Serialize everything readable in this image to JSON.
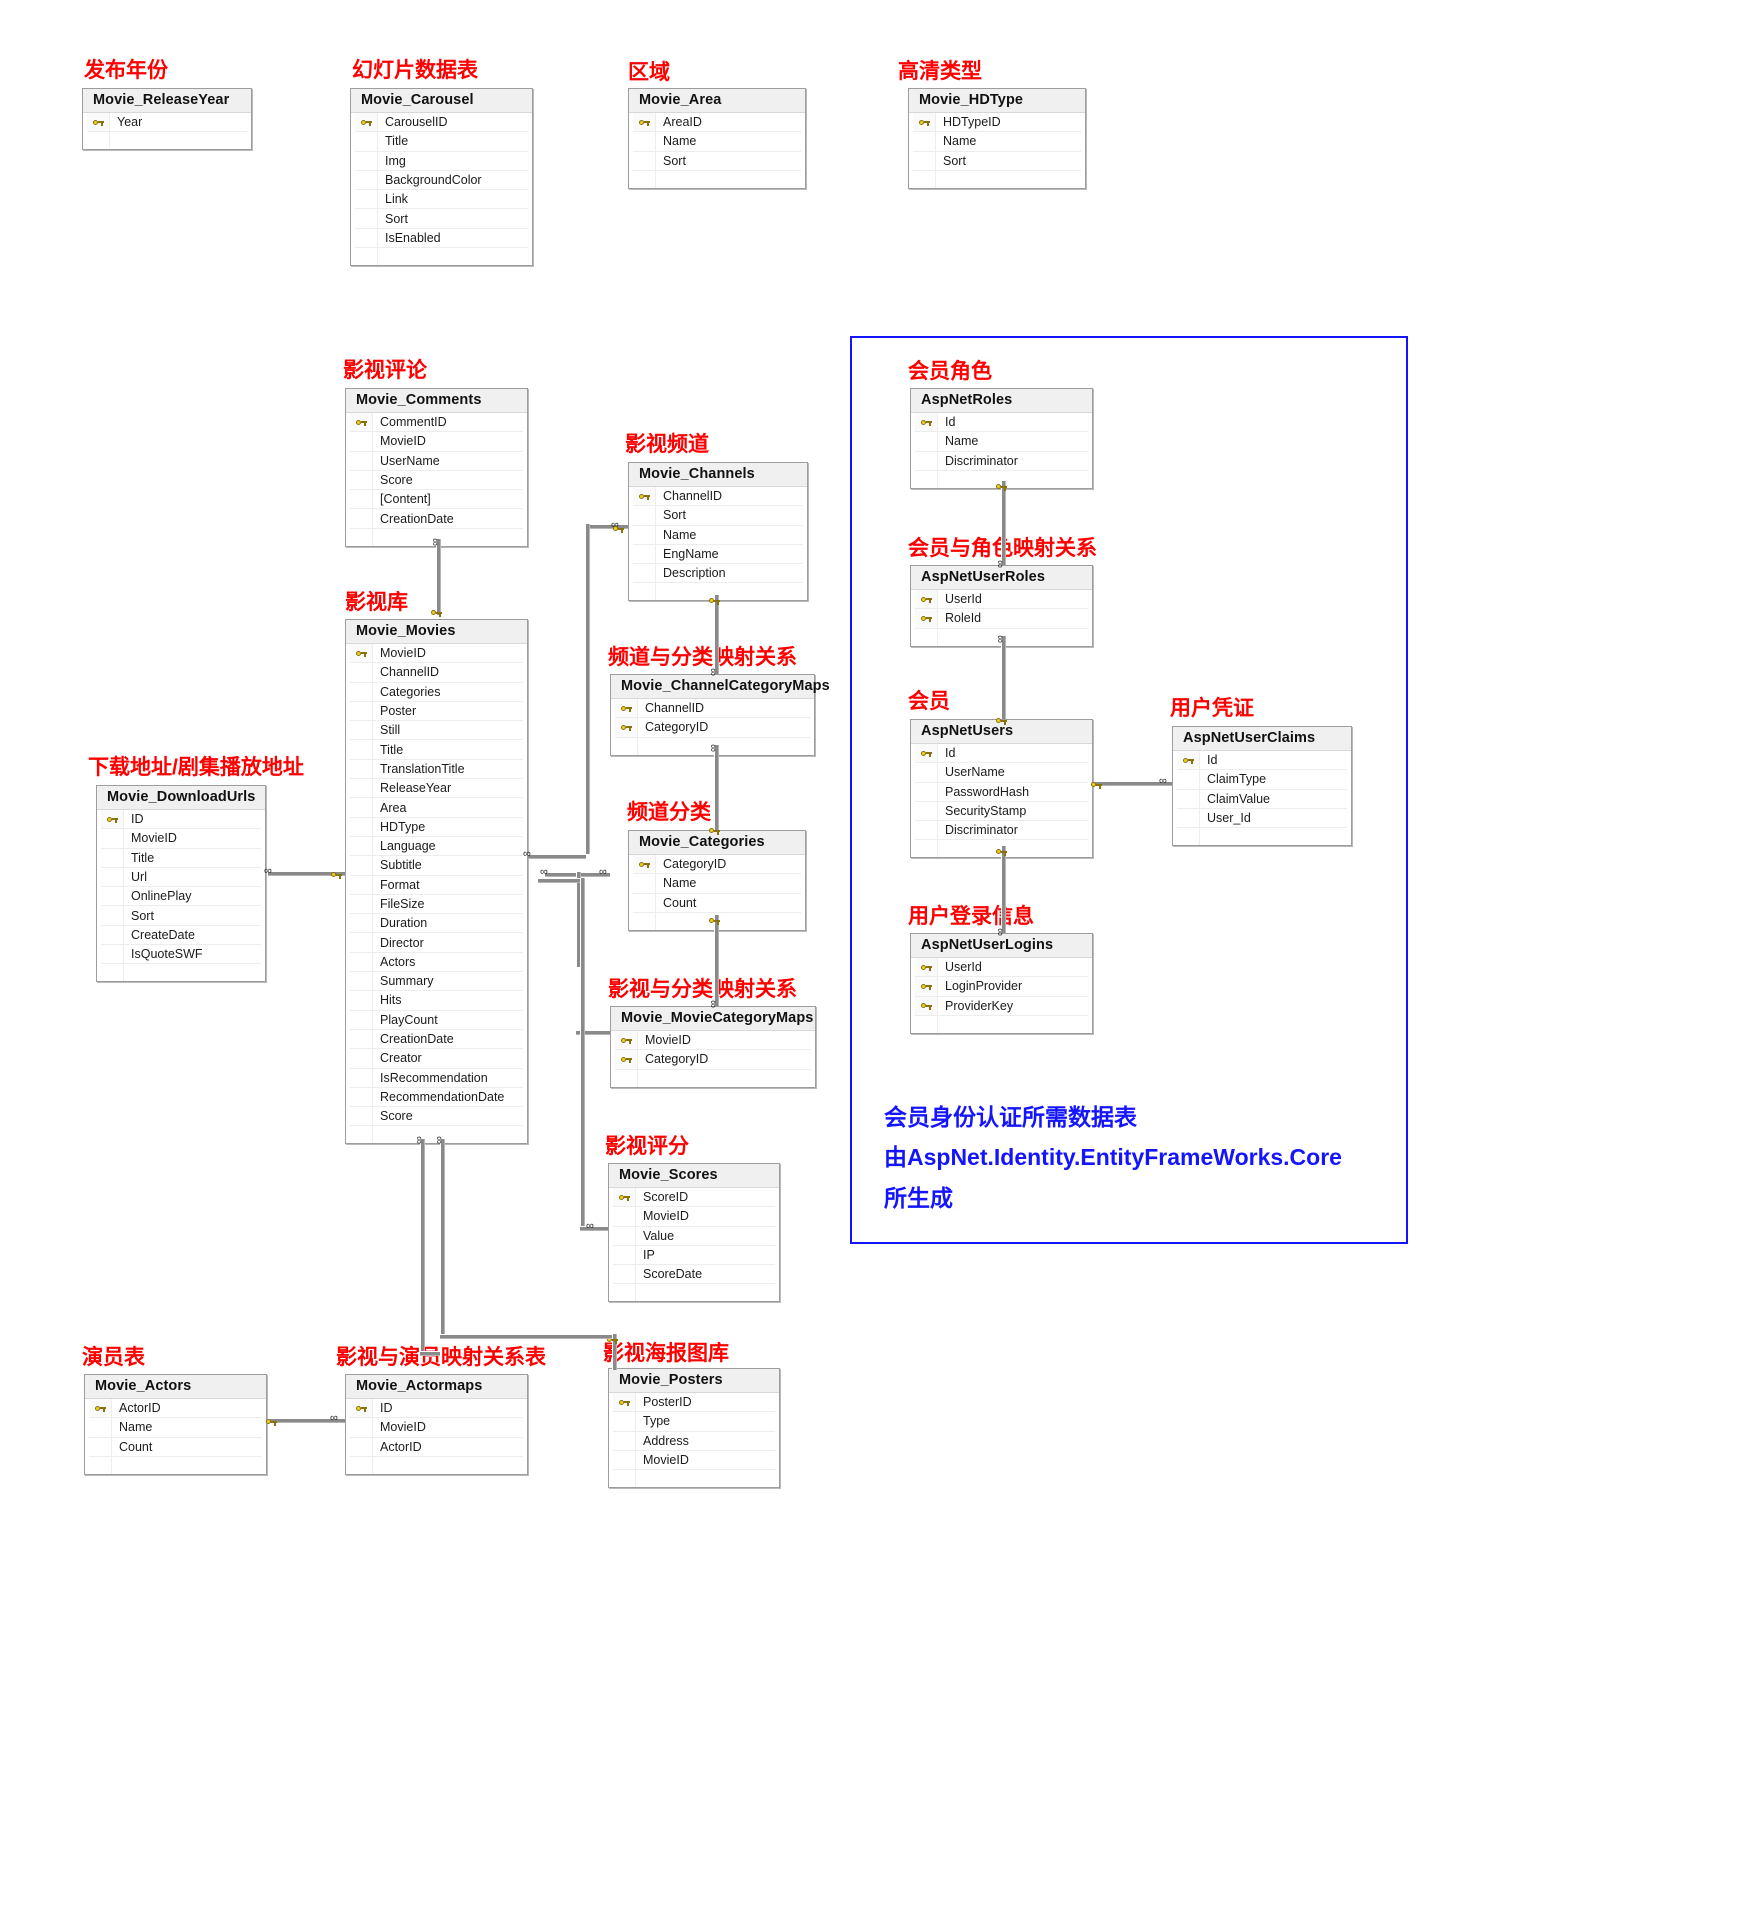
{
  "diagram": {
    "title_note_lines": [
      "会员身份认证所需数据表",
      "由AspNet.Identity.EntityFrameWorks.Core",
      "所生成"
    ],
    "colors": {
      "annotation": "#ff0000",
      "note": "#1414ff",
      "header_bg": "#f0f0f0",
      "border": "#9d9d9d",
      "key": "#f2cf26"
    }
  },
  "tables": [
    {
      "id": "movie-releaseyear",
      "annotation": "发布年份",
      "name": "Movie_ReleaseYear",
      "fields": [
        {
          "name": "Year",
          "key": true
        }
      ]
    },
    {
      "id": "movie-carousel",
      "annotation": "幻灯片数据表",
      "name": "Movie_Carousel",
      "fields": [
        {
          "name": "CarouselID",
          "key": true
        },
        {
          "name": "Title",
          "key": false
        },
        {
          "name": "Img",
          "key": false
        },
        {
          "name": "BackgroundColor",
          "key": false
        },
        {
          "name": "Link",
          "key": false
        },
        {
          "name": "Sort",
          "key": false
        },
        {
          "name": "IsEnabled",
          "key": false
        }
      ]
    },
    {
      "id": "movie-area",
      "annotation": "区域",
      "name": "Movie_Area",
      "fields": [
        {
          "name": "AreaID",
          "key": true
        },
        {
          "name": "Name",
          "key": false
        },
        {
          "name": "Sort",
          "key": false
        }
      ]
    },
    {
      "id": "movie-hdtype",
      "annotation": "高清类型",
      "name": "Movie_HDType",
      "fields": [
        {
          "name": "HDTypeID",
          "key": true
        },
        {
          "name": "Name",
          "key": false
        },
        {
          "name": "Sort",
          "key": false
        }
      ]
    },
    {
      "id": "movie-comments",
      "annotation": "影视评论",
      "name": "Movie_Comments",
      "fields": [
        {
          "name": "CommentID",
          "key": true
        },
        {
          "name": "MovieID",
          "key": false
        },
        {
          "name": "UserName",
          "key": false
        },
        {
          "name": "Score",
          "key": false
        },
        {
          "name": "[Content]",
          "key": false
        },
        {
          "name": "CreationDate",
          "key": false
        }
      ]
    },
    {
      "id": "movie-channels",
      "annotation": "影视频道",
      "name": "Movie_Channels",
      "fields": [
        {
          "name": "ChannelID",
          "key": true
        },
        {
          "name": "Sort",
          "key": false
        },
        {
          "name": "Name",
          "key": false
        },
        {
          "name": "EngName",
          "key": false
        },
        {
          "name": "Description",
          "key": false
        }
      ]
    },
    {
      "id": "movie-movies",
      "annotation": "影视库",
      "name": "Movie_Movies",
      "fields": [
        {
          "name": "MovieID",
          "key": true
        },
        {
          "name": "ChannelID",
          "key": false
        },
        {
          "name": "Categories",
          "key": false
        },
        {
          "name": "Poster",
          "key": false
        },
        {
          "name": "Still",
          "key": false
        },
        {
          "name": "Title",
          "key": false
        },
        {
          "name": "TranslationTitle",
          "key": false
        },
        {
          "name": "ReleaseYear",
          "key": false
        },
        {
          "name": "Area",
          "key": false
        },
        {
          "name": "HDType",
          "key": false
        },
        {
          "name": "Language",
          "key": false
        },
        {
          "name": "Subtitle",
          "key": false
        },
        {
          "name": "Format",
          "key": false
        },
        {
          "name": "FileSize",
          "key": false
        },
        {
          "name": "Duration",
          "key": false
        },
        {
          "name": "Director",
          "key": false
        },
        {
          "name": "Actors",
          "key": false
        },
        {
          "name": "Summary",
          "key": false
        },
        {
          "name": "Hits",
          "key": false
        },
        {
          "name": "PlayCount",
          "key": false
        },
        {
          "name": "CreationDate",
          "key": false
        },
        {
          "name": "Creator",
          "key": false
        },
        {
          "name": "IsRecommendation",
          "key": false
        },
        {
          "name": "RecommendationDate",
          "key": false
        },
        {
          "name": "Score",
          "key": false
        }
      ]
    },
    {
      "id": "movie-downloadurls",
      "annotation": "下载地址/剧集播放地址",
      "name": "Movie_DownloadUrls",
      "fields": [
        {
          "name": "ID",
          "key": true
        },
        {
          "name": "MovieID",
          "key": false
        },
        {
          "name": "Title",
          "key": false
        },
        {
          "name": "Url",
          "key": false
        },
        {
          "name": "OnlinePlay",
          "key": false
        },
        {
          "name": "Sort",
          "key": false
        },
        {
          "name": "CreateDate",
          "key": false
        },
        {
          "name": "IsQuoteSWF",
          "key": false
        }
      ]
    },
    {
      "id": "movie-channelcategorymaps",
      "annotation": "频道与分类映射关系",
      "name": "Movie_ChannelCategoryMaps",
      "fields": [
        {
          "name": "ChannelID",
          "key": true
        },
        {
          "name": "CategoryID",
          "key": true
        }
      ]
    },
    {
      "id": "movie-categories",
      "annotation": "频道分类",
      "name": "Movie_Categories",
      "fields": [
        {
          "name": "CategoryID",
          "key": true
        },
        {
          "name": "Name",
          "key": false
        },
        {
          "name": "Count",
          "key": false
        }
      ]
    },
    {
      "id": "movie-moviecategorymaps",
      "annotation": "影视与分类映射关系",
      "name": "Movie_MovieCategoryMaps",
      "fields": [
        {
          "name": "MovieID",
          "key": true
        },
        {
          "name": "CategoryID",
          "key": true
        }
      ]
    },
    {
      "id": "movie-scores",
      "annotation": "影视评分",
      "name": "Movie_Scores",
      "fields": [
        {
          "name": "ScoreID",
          "key": true
        },
        {
          "name": "MovieID",
          "key": false
        },
        {
          "name": "Value",
          "key": false
        },
        {
          "name": "IP",
          "key": false
        },
        {
          "name": "ScoreDate",
          "key": false
        }
      ]
    },
    {
      "id": "movie-actors",
      "annotation": "演员表",
      "name": "Movie_Actors",
      "fields": [
        {
          "name": "ActorID",
          "key": true
        },
        {
          "name": "Name",
          "key": false
        },
        {
          "name": "Count",
          "key": false
        }
      ]
    },
    {
      "id": "movie-actormaps",
      "annotation": "影视与演员映射关系表",
      "name": "Movie_Actormaps",
      "fields": [
        {
          "name": "ID",
          "key": true
        },
        {
          "name": "MovieID",
          "key": false
        },
        {
          "name": "ActorID",
          "key": false
        }
      ]
    },
    {
      "id": "movie-posters",
      "annotation": "影视海报图库",
      "name": "Movie_Posters",
      "fields": [
        {
          "name": "PosterID",
          "key": true
        },
        {
          "name": "Type",
          "key": false
        },
        {
          "name": "Address",
          "key": false
        },
        {
          "name": "MovieID",
          "key": false
        }
      ]
    },
    {
      "id": "aspnetroles",
      "annotation": "会员角色",
      "name": "AspNetRoles",
      "fields": [
        {
          "name": "Id",
          "key": true
        },
        {
          "name": "Name",
          "key": false
        },
        {
          "name": "Discriminator",
          "key": false
        }
      ]
    },
    {
      "id": "aspnetuserroles",
      "annotation": "会员与角色映射关系",
      "name": "AspNetUserRoles",
      "fields": [
        {
          "name": "UserId",
          "key": true
        },
        {
          "name": "RoleId",
          "key": true
        }
      ]
    },
    {
      "id": "aspnetusers",
      "annotation": "会员",
      "name": "AspNetUsers",
      "fields": [
        {
          "name": "Id",
          "key": true
        },
        {
          "name": "UserName",
          "key": false
        },
        {
          "name": "PasswordHash",
          "key": false
        },
        {
          "name": "SecurityStamp",
          "key": false
        },
        {
          "name": "Discriminator",
          "key": false
        }
      ]
    },
    {
      "id": "aspnetuserclaims",
      "annotation": "用户凭证",
      "name": "AspNetUserClaims",
      "fields": [
        {
          "name": "Id",
          "key": true
        },
        {
          "name": "ClaimType",
          "key": false
        },
        {
          "name": "ClaimValue",
          "key": false
        },
        {
          "name": "User_Id",
          "key": false
        }
      ]
    },
    {
      "id": "aspnetuserlogins",
      "annotation": "用户登录信息",
      "name": "AspNetUserLogins",
      "fields": [
        {
          "name": "UserId",
          "key": true
        },
        {
          "name": "LoginProvider",
          "key": true
        },
        {
          "name": "ProviderKey",
          "key": true
        }
      ]
    }
  ]
}
